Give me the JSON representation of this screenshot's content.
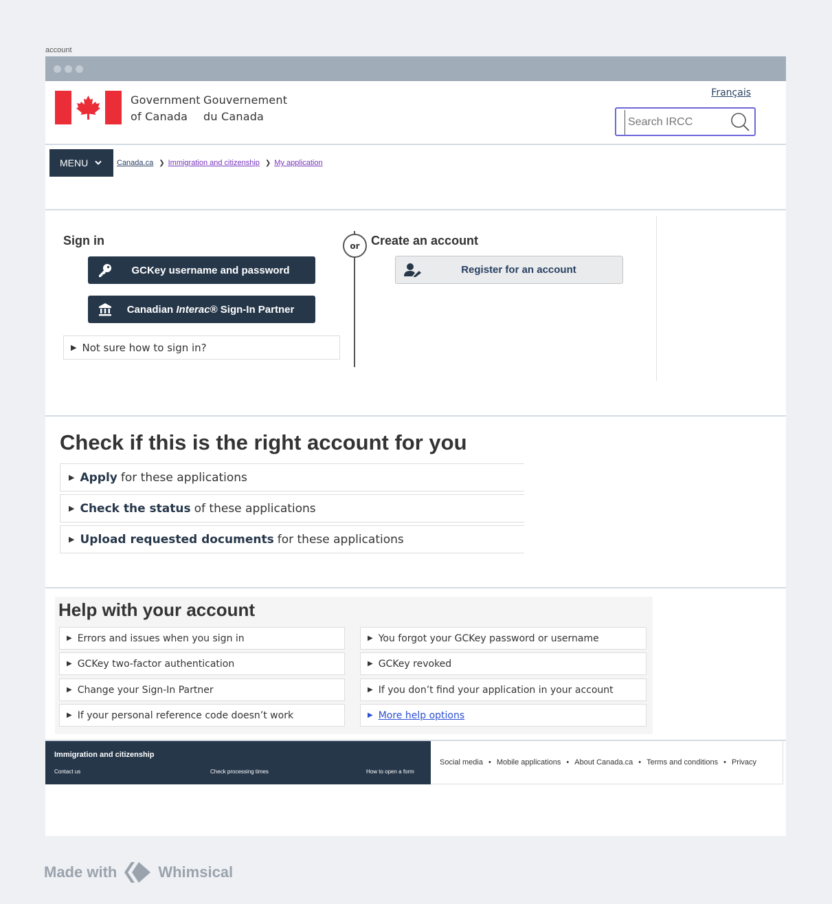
{
  "frame": {
    "label": "account"
  },
  "header": {
    "gov_en_line1": "Government",
    "gov_en_line2": "of Canada",
    "gov_fr_line1": "Gouvernement",
    "gov_fr_line2": "du Canada",
    "language_link": "Français",
    "search_placeholder": "Search IRCC"
  },
  "nav": {
    "menu_label": "MENU",
    "breadcrumbs": [
      "Canada.ca",
      "Immigration and citizenship",
      "My application"
    ]
  },
  "signin": {
    "title": "Sign in",
    "gckey_button": "GCKey username and password",
    "interac_prefix": "Canadian ",
    "interac_italic": "Interac",
    "interac_suffix": "® Sign-In Partner",
    "not_sure": "Not sure how to sign in?",
    "or_label": "or",
    "create_title": "Create an account",
    "register_button": "Register for an account"
  },
  "check": {
    "title": "Check if this is the right account for you",
    "items": [
      {
        "bold": "Apply",
        "rest": "for these applications"
      },
      {
        "bold": "Check the status",
        "rest": "of these applications"
      },
      {
        "bold": "Upload requested documents",
        "rest": "for these applications"
      }
    ]
  },
  "help": {
    "title": "Help with your account",
    "left_items": [
      "Errors and issues when you sign in",
      "GCKey two-factor authentication",
      "Change your Sign-In Partner",
      "If your personal reference code doesn’t work"
    ],
    "right_items": [
      "You forgot your GCKey password or username",
      "GCKey revoked",
      "If you don’t find your application in your account",
      "More help options"
    ]
  },
  "footer": {
    "section_title": "Immigration and citizenship",
    "links": [
      "Contact us",
      "Check processing times",
      "How to open a form"
    ],
    "legal_links": [
      "Social media",
      "Mobile applications",
      "About Canada.ca",
      "Terms and conditions",
      "Privacy"
    ]
  },
  "branding": {
    "made_with": "Made with",
    "brand": "Whimsical"
  },
  "colors": {
    "nav_dark": "#26374a",
    "flag_red": "#eb2d37",
    "link_blue": "#2b4fd1",
    "visited_purple": "#7834bc",
    "search_border": "#6e67d9"
  }
}
